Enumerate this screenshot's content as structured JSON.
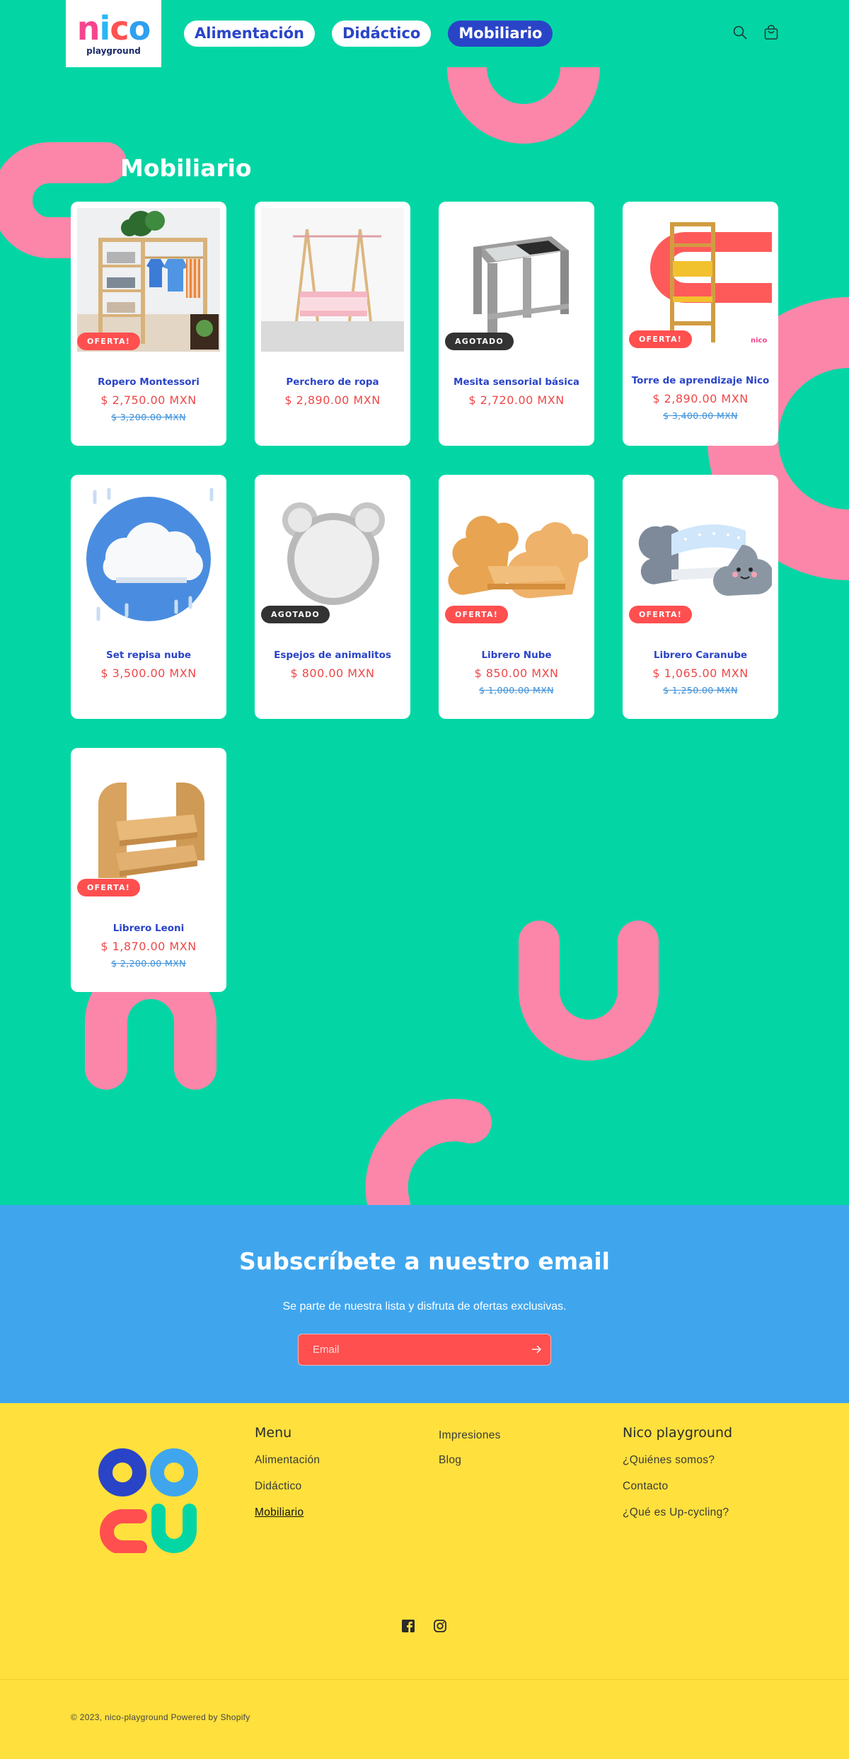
{
  "colors": {
    "background": "#03d6a4",
    "accent_pink": "#fb86a9",
    "nav_blue": "#2a44c8",
    "sale_red": "#ff4f4f",
    "newsletter_blue": "#3fa6ee",
    "footer_yellow": "#ffe03d"
  },
  "header": {
    "logo_word": "nico",
    "logo_sub": "playground",
    "nav": [
      {
        "label": "Alimentación",
        "active": false
      },
      {
        "label": "Didáctico",
        "active": false
      },
      {
        "label": "Mobiliario",
        "active": true
      }
    ],
    "icons": [
      "search-icon",
      "cart-icon"
    ]
  },
  "collection": {
    "title": "Mobiliario",
    "products": [
      {
        "title": "Ropero Montessori",
        "price": "$ 2,750.00 MXN",
        "compare": "$ 3,200.00 MXN",
        "badge": "OFERTA!"
      },
      {
        "title": "Perchero de ropa",
        "price": "$ 2,890.00 MXN",
        "compare": "",
        "badge": ""
      },
      {
        "title": "Mesita sensorial básica",
        "price": "$ 2,720.00 MXN",
        "compare": "",
        "badge": "AGOTADO"
      },
      {
        "title": "Torre de aprendizaje Nico",
        "price": "$ 2,890.00 MXN",
        "compare": "$ 3,400.00 MXN",
        "badge": "OFERTA!"
      },
      {
        "title": "Set repisa nube",
        "price": "$ 3,500.00 MXN",
        "compare": "",
        "badge": ""
      },
      {
        "title": "Espejos de animalitos",
        "price": "$ 800.00 MXN",
        "compare": "",
        "badge": "AGOTADO"
      },
      {
        "title": "Librero Nube",
        "price": "$ 850.00 MXN",
        "compare": "$ 1,000.00 MXN",
        "badge": "OFERTA!"
      },
      {
        "title": "Librero Caranube",
        "price": "$ 1,065.00 MXN",
        "compare": "$ 1,250.00 MXN",
        "badge": "OFERTA!"
      },
      {
        "title": "Librero Leoni",
        "price": "$ 1,870.00 MXN",
        "compare": "$ 2,200.00 MXN",
        "badge": "OFERTA!"
      }
    ]
  },
  "newsletter": {
    "title": "Subscríbete a nuestro email",
    "subtitle": "Se parte de nuestra lista y disfruta de ofertas exclusivas.",
    "email_placeholder": "Email"
  },
  "footer": {
    "menu_heading": "Menu",
    "menu_links": [
      "Alimentación",
      "Didáctico",
      "Mobiliario"
    ],
    "extra_links": [
      "Impresiones",
      "Blog"
    ],
    "company_heading": "Nico playground",
    "company_links": [
      "¿Quiénes somos?",
      "Contacto",
      "¿Qué es Up-cycling?"
    ],
    "social": [
      "facebook-icon",
      "instagram-icon"
    ],
    "copyright": "© 2023, nico-playground Powered by Shopify"
  }
}
